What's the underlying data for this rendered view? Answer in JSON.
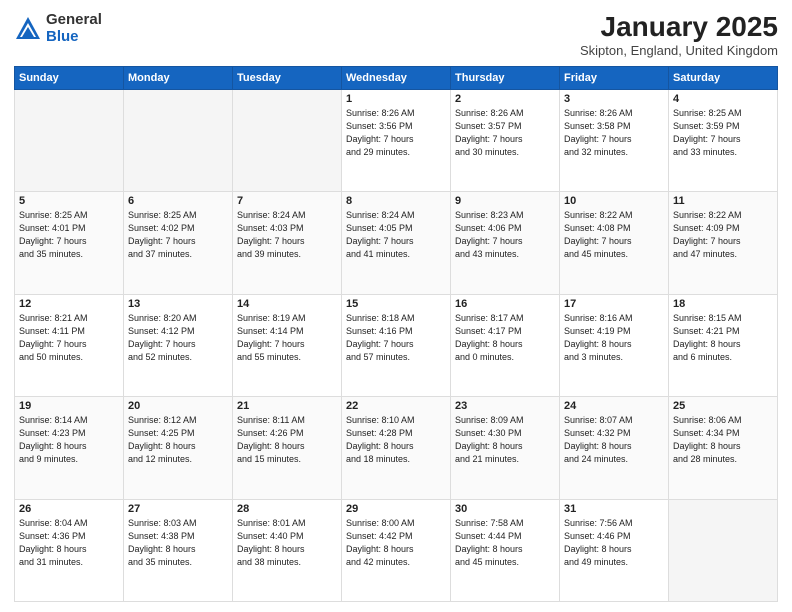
{
  "header": {
    "logo_line1": "General",
    "logo_line2": "Blue",
    "month": "January 2025",
    "location": "Skipton, England, United Kingdom"
  },
  "weekdays": [
    "Sunday",
    "Monday",
    "Tuesday",
    "Wednesday",
    "Thursday",
    "Friday",
    "Saturday"
  ],
  "weeks": [
    [
      {
        "day": "",
        "info": ""
      },
      {
        "day": "",
        "info": ""
      },
      {
        "day": "",
        "info": ""
      },
      {
        "day": "1",
        "info": "Sunrise: 8:26 AM\nSunset: 3:56 PM\nDaylight: 7 hours\nand 29 minutes."
      },
      {
        "day": "2",
        "info": "Sunrise: 8:26 AM\nSunset: 3:57 PM\nDaylight: 7 hours\nand 30 minutes."
      },
      {
        "day": "3",
        "info": "Sunrise: 8:26 AM\nSunset: 3:58 PM\nDaylight: 7 hours\nand 32 minutes."
      },
      {
        "day": "4",
        "info": "Sunrise: 8:25 AM\nSunset: 3:59 PM\nDaylight: 7 hours\nand 33 minutes."
      }
    ],
    [
      {
        "day": "5",
        "info": "Sunrise: 8:25 AM\nSunset: 4:01 PM\nDaylight: 7 hours\nand 35 minutes."
      },
      {
        "day": "6",
        "info": "Sunrise: 8:25 AM\nSunset: 4:02 PM\nDaylight: 7 hours\nand 37 minutes."
      },
      {
        "day": "7",
        "info": "Sunrise: 8:24 AM\nSunset: 4:03 PM\nDaylight: 7 hours\nand 39 minutes."
      },
      {
        "day": "8",
        "info": "Sunrise: 8:24 AM\nSunset: 4:05 PM\nDaylight: 7 hours\nand 41 minutes."
      },
      {
        "day": "9",
        "info": "Sunrise: 8:23 AM\nSunset: 4:06 PM\nDaylight: 7 hours\nand 43 minutes."
      },
      {
        "day": "10",
        "info": "Sunrise: 8:22 AM\nSunset: 4:08 PM\nDaylight: 7 hours\nand 45 minutes."
      },
      {
        "day": "11",
        "info": "Sunrise: 8:22 AM\nSunset: 4:09 PM\nDaylight: 7 hours\nand 47 minutes."
      }
    ],
    [
      {
        "day": "12",
        "info": "Sunrise: 8:21 AM\nSunset: 4:11 PM\nDaylight: 7 hours\nand 50 minutes."
      },
      {
        "day": "13",
        "info": "Sunrise: 8:20 AM\nSunset: 4:12 PM\nDaylight: 7 hours\nand 52 minutes."
      },
      {
        "day": "14",
        "info": "Sunrise: 8:19 AM\nSunset: 4:14 PM\nDaylight: 7 hours\nand 55 minutes."
      },
      {
        "day": "15",
        "info": "Sunrise: 8:18 AM\nSunset: 4:16 PM\nDaylight: 7 hours\nand 57 minutes."
      },
      {
        "day": "16",
        "info": "Sunrise: 8:17 AM\nSunset: 4:17 PM\nDaylight: 8 hours\nand 0 minutes."
      },
      {
        "day": "17",
        "info": "Sunrise: 8:16 AM\nSunset: 4:19 PM\nDaylight: 8 hours\nand 3 minutes."
      },
      {
        "day": "18",
        "info": "Sunrise: 8:15 AM\nSunset: 4:21 PM\nDaylight: 8 hours\nand 6 minutes."
      }
    ],
    [
      {
        "day": "19",
        "info": "Sunrise: 8:14 AM\nSunset: 4:23 PM\nDaylight: 8 hours\nand 9 minutes."
      },
      {
        "day": "20",
        "info": "Sunrise: 8:12 AM\nSunset: 4:25 PM\nDaylight: 8 hours\nand 12 minutes."
      },
      {
        "day": "21",
        "info": "Sunrise: 8:11 AM\nSunset: 4:26 PM\nDaylight: 8 hours\nand 15 minutes."
      },
      {
        "day": "22",
        "info": "Sunrise: 8:10 AM\nSunset: 4:28 PM\nDaylight: 8 hours\nand 18 minutes."
      },
      {
        "day": "23",
        "info": "Sunrise: 8:09 AM\nSunset: 4:30 PM\nDaylight: 8 hours\nand 21 minutes."
      },
      {
        "day": "24",
        "info": "Sunrise: 8:07 AM\nSunset: 4:32 PM\nDaylight: 8 hours\nand 24 minutes."
      },
      {
        "day": "25",
        "info": "Sunrise: 8:06 AM\nSunset: 4:34 PM\nDaylight: 8 hours\nand 28 minutes."
      }
    ],
    [
      {
        "day": "26",
        "info": "Sunrise: 8:04 AM\nSunset: 4:36 PM\nDaylight: 8 hours\nand 31 minutes."
      },
      {
        "day": "27",
        "info": "Sunrise: 8:03 AM\nSunset: 4:38 PM\nDaylight: 8 hours\nand 35 minutes."
      },
      {
        "day": "28",
        "info": "Sunrise: 8:01 AM\nSunset: 4:40 PM\nDaylight: 8 hours\nand 38 minutes."
      },
      {
        "day": "29",
        "info": "Sunrise: 8:00 AM\nSunset: 4:42 PM\nDaylight: 8 hours\nand 42 minutes."
      },
      {
        "day": "30",
        "info": "Sunrise: 7:58 AM\nSunset: 4:44 PM\nDaylight: 8 hours\nand 45 minutes."
      },
      {
        "day": "31",
        "info": "Sunrise: 7:56 AM\nSunset: 4:46 PM\nDaylight: 8 hours\nand 49 minutes."
      },
      {
        "day": "",
        "info": ""
      }
    ]
  ]
}
